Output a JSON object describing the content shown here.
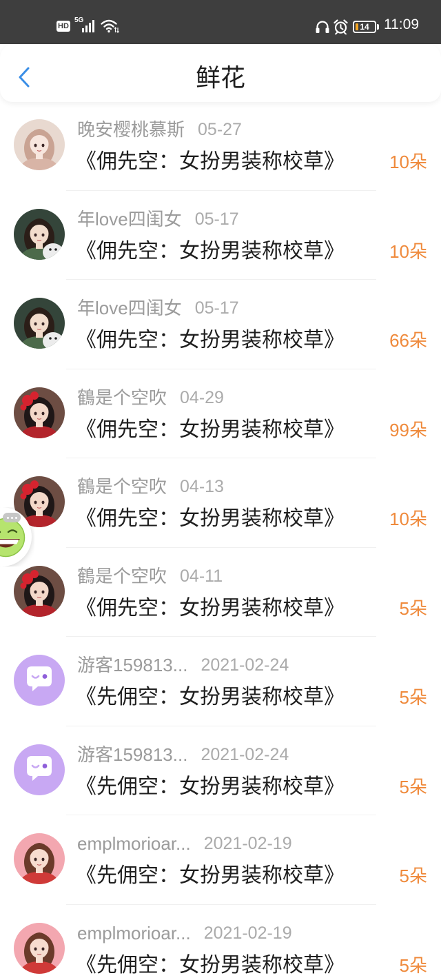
{
  "status_bar": {
    "hd_badge": "HD",
    "network": "5G",
    "battery": "14",
    "time": "11:09",
    "icons": {
      "signal": "signal-icon",
      "wifi": "wifi-icon",
      "headphones": "headphones-icon",
      "alarm": "alarm-icon",
      "battery": "battery-icon"
    }
  },
  "header": {
    "back_icon": "chevron-left-icon",
    "title": "鲜花"
  },
  "colors": {
    "status_bar_bg": "#3e3e3e",
    "accent": "#3a8ee6",
    "amount": "#ef8a3c",
    "user_name": "#9b9b9b",
    "date": "#ababab",
    "book_title": "#1f1f1f"
  },
  "gifts": [
    {
      "user": "晚安樱桃慕斯",
      "date": "05-27",
      "book": "《佣先空：女扮男装称校草》",
      "amount": "10朵",
      "avatar": {
        "icon": "portrait-photo-icon",
        "colors": {
          "bg": "#e8d9d0",
          "hair": "#c9a393",
          "skin": "#f7e6de",
          "cloth": "#d8b4a6"
        }
      }
    },
    {
      "user": "年love四闺女",
      "date": "05-17",
      "book": "《佣先空：女扮男装称校草》",
      "amount": "10朵",
      "avatar": {
        "icon": "portrait-photo-icon",
        "colors": {
          "bg": "#34453a",
          "hair": "#2b1e18",
          "skin": "#f2dccc",
          "cloth": "#4c6a4a",
          "detail": "#ececec"
        }
      }
    },
    {
      "user": "年love四闺女",
      "date": "05-17",
      "book": "《佣先空：女扮男装称校草》",
      "amount": "66朵",
      "avatar": {
        "icon": "portrait-photo-icon",
        "colors": {
          "bg": "#34453a",
          "hair": "#2b1e18",
          "skin": "#f2dccc",
          "cloth": "#4c6a4a",
          "detail": "#ececec"
        }
      }
    },
    {
      "user": "鶴是个空吹",
      "date": "04-29",
      "book": "《佣先空：女扮男装称校草》",
      "amount": "99朵",
      "avatar": {
        "icon": "portrait-photo-icon",
        "colors": {
          "bg": "#6d4d43",
          "hair": "#1f1717",
          "skin": "#f3d8c9",
          "cloth": "#b3242b",
          "accent": "#d6232f"
        }
      }
    },
    {
      "user": "鶴是个空吹",
      "date": "04-13",
      "book": "《佣先空：女扮男装称校草》",
      "amount": "10朵",
      "avatar": {
        "icon": "portrait-photo-icon",
        "colors": {
          "bg": "#6d4d43",
          "hair": "#1f1717",
          "skin": "#f3d8c9",
          "cloth": "#b3242b",
          "accent": "#d6232f"
        }
      }
    },
    {
      "user": "鶴是个空吹",
      "date": "04-11",
      "book": "《佣先空：女扮男装称校草》",
      "amount": "5朵",
      "avatar": {
        "icon": "portrait-photo-icon",
        "colors": {
          "bg": "#6d4d43",
          "hair": "#1f1717",
          "skin": "#f3d8c9",
          "cloth": "#b3242b",
          "accent": "#d6232f"
        }
      }
    },
    {
      "user": "游客159813...",
      "date": "2021-02-24",
      "book": "《先佣空：女扮男装称校草》",
      "amount": "5朵",
      "avatar": {
        "icon": "guest-chat-bubble-icon",
        "colors": {
          "bg": "#c8a8f3",
          "accent": "#8f5fda"
        }
      }
    },
    {
      "user": "游客159813...",
      "date": "2021-02-24",
      "book": "《先佣空：女扮男装称校草》",
      "amount": "5朵",
      "avatar": {
        "icon": "guest-chat-bubble-icon",
        "colors": {
          "bg": "#c8a8f3",
          "accent": "#8f5fda"
        }
      }
    },
    {
      "user": "emplmorioar...",
      "date": "2021-02-19",
      "book": "《先佣空：女扮男装称校草》",
      "amount": "5朵",
      "avatar": {
        "icon": "portrait-photo-icon",
        "colors": {
          "bg": "#f3a7b0",
          "hair": "#6b3a2a",
          "skin": "#f7dccf",
          "cloth": "#cf3a38"
        }
      }
    },
    {
      "user": "emplmorioar...",
      "date": "2021-02-19",
      "book": "《先佣空：女扮男装称校草》",
      "amount": "5朵",
      "avatar": {
        "icon": "portrait-photo-icon",
        "colors": {
          "bg": "#f3a7b0",
          "hair": "#6b3a2a",
          "skin": "#f7dccf",
          "cloth": "#cf3a38"
        }
      }
    }
  ],
  "floating_button": {
    "icon": "laughing-emoji-icon",
    "badge_icon": "more-dots-icon"
  }
}
